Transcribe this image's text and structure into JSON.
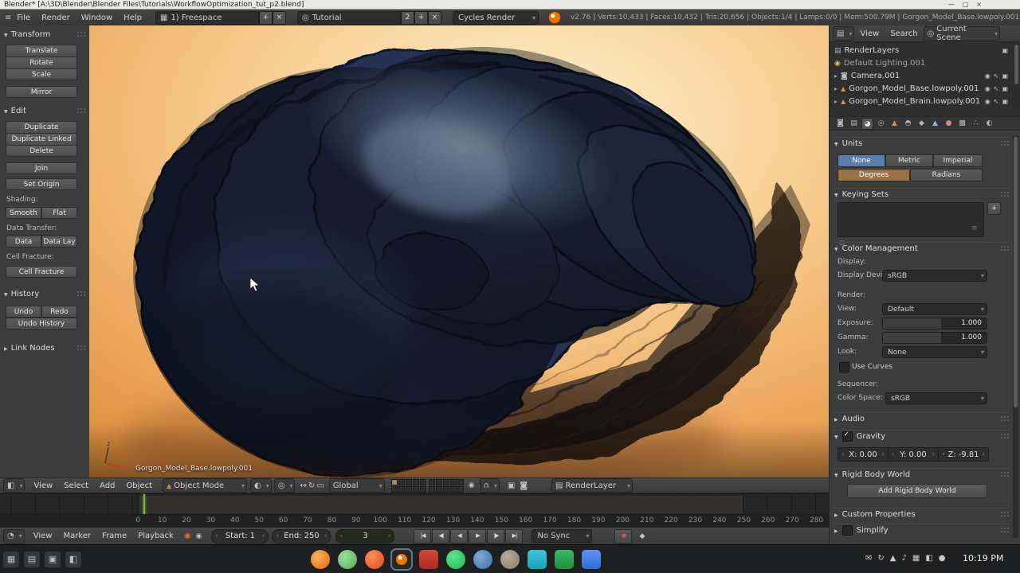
{
  "window": {
    "title": "Blender* [A:\\3D\\Blender\\Blender Files\\Tutorials\\WorkflowOptimization_tut_p2.blend]"
  },
  "header": {
    "menus": [
      "File",
      "Render",
      "Window",
      "Help"
    ],
    "layout": "1) Freespace",
    "scene": "Tutorial",
    "scene_users": "2",
    "engine": "Cycles Render",
    "stats": "v2.76 | Verts:10,433 | Faces:10,432 | Tris:20,656 | Objects:1/4 | Lamps:0/0 | Mem:500.79M | Gorgon_Model_Base.lowpoly.001"
  },
  "tool_shelf": {
    "transform_title": "Transform",
    "transform_buttons": [
      "Translate",
      "Rotate",
      "Scale"
    ],
    "mirror": "Mirror",
    "edit_title": "Edit",
    "edit_buttons": [
      "Duplicate",
      "Duplicate Linked",
      "Delete"
    ],
    "join": "Join",
    "set_origin": "Set Origin",
    "shading_label": "Shading:",
    "smooth": "Smooth",
    "flat": "Flat",
    "data_transfer_label": "Data Transfer:",
    "data": "Data",
    "data_lay": "Data Lay",
    "cell_fracture_label": "Cell Fracture:",
    "cell_fracture": "Cell Fracture",
    "history_title": "History",
    "undo": "Undo",
    "redo": "Redo",
    "undo_history": "Undo History",
    "link_nodes": "Link Nodes"
  },
  "viewport": {
    "object_name": "Gorgon_Model_Base.lowpoly.001",
    "axis_x": "x",
    "axis_z": "z"
  },
  "viewport_header": {
    "menus": [
      "View",
      "Select",
      "Add",
      "Object"
    ],
    "mode": "Object Mode",
    "orientation": "Global",
    "render_layer": "RenderLayer"
  },
  "outliner": {
    "menus": [
      "View",
      "Search"
    ],
    "scope": "Current Scene",
    "items": [
      {
        "label": "RenderLayers"
      },
      {
        "label": "Default Lighting.001"
      },
      {
        "label": "Camera.001"
      },
      {
        "label": "Gorgon_Model_Base.lowpoly.001"
      },
      {
        "label": "Gorgon_Model_Brain.lowpoly.001"
      }
    ]
  },
  "properties": {
    "tabs": [
      "render",
      "render-layers",
      "scene",
      "world",
      "object",
      "constraints",
      "modifiers",
      "object-data",
      "material",
      "texture",
      "particles",
      "physics"
    ],
    "units_title": "Units",
    "unit_system": [
      "None",
      "Metric",
      "Imperial"
    ],
    "unit_rotation": [
      "Degrees",
      "Radians"
    ],
    "keying_title": "Keying Sets",
    "cm_title": "Color Management",
    "display_label": "Display:",
    "display_device_label": "Display Devi...",
    "display_device": "sRGB",
    "render_label": "Render:",
    "view_label": "View:",
    "view_value": "Default",
    "exposure_label": "Exposure:",
    "exposure": "1.000",
    "gamma_label": "Gamma:",
    "gamma": "1.000",
    "look_label": "Look:",
    "look_value": "None",
    "use_curves": "Use Curves",
    "sequencer_label": "Sequencer:",
    "color_space_label": "Color Space:",
    "color_space": "sRGB",
    "audio_title": "Audio",
    "gravity_title": "Gravity",
    "gravity_x_label": "X:",
    "gravity_x": "0.00",
    "gravity_y_label": "Y:",
    "gravity_y": "0.00",
    "gravity_z_label": "Z:",
    "gravity_z": "-9.81",
    "rigid_title": "Rigid Body World",
    "rigid_button": "Add Rigid Body World",
    "custom_title": "Custom Properties",
    "simplify_title": "Simplify"
  },
  "timeline": {
    "menus": [
      "View",
      "Marker",
      "Frame",
      "Playback"
    ],
    "ticks": [
      "0",
      "10",
      "20",
      "30",
      "40",
      "50",
      "60",
      "70",
      "80",
      "90",
      "100",
      "110",
      "120",
      "130",
      "140",
      "150",
      "160",
      "170",
      "180",
      "190",
      "200",
      "210",
      "220",
      "230",
      "240",
      "250",
      "260",
      "270",
      "280"
    ],
    "start_label": "Start:",
    "start": "1",
    "end_label": "End:",
    "end": "250",
    "frame": "3",
    "sync": "No Sync"
  },
  "taskbar": {
    "left_icons": [
      "launcher",
      "files",
      "workspaces",
      "display"
    ],
    "app_icons": [
      "firefox",
      "software-center",
      "ubuntu",
      "blender",
      "pdf-reader",
      "spotify",
      "steam",
      "gimp",
      "media-player",
      "spreadsheet",
      "text-editor"
    ],
    "tray_icons": [
      "mail",
      "updates",
      "input",
      "audio",
      "workspace",
      "display",
      "status"
    ],
    "clock": "10:19 PM"
  },
  "colors": {
    "accent_blue": "#567fac",
    "accent_tan": "#9a7344",
    "frame_line_green": "#7cb43c",
    "blender_orange": "#ea7600",
    "viewport_sky": "#f7cf93"
  }
}
